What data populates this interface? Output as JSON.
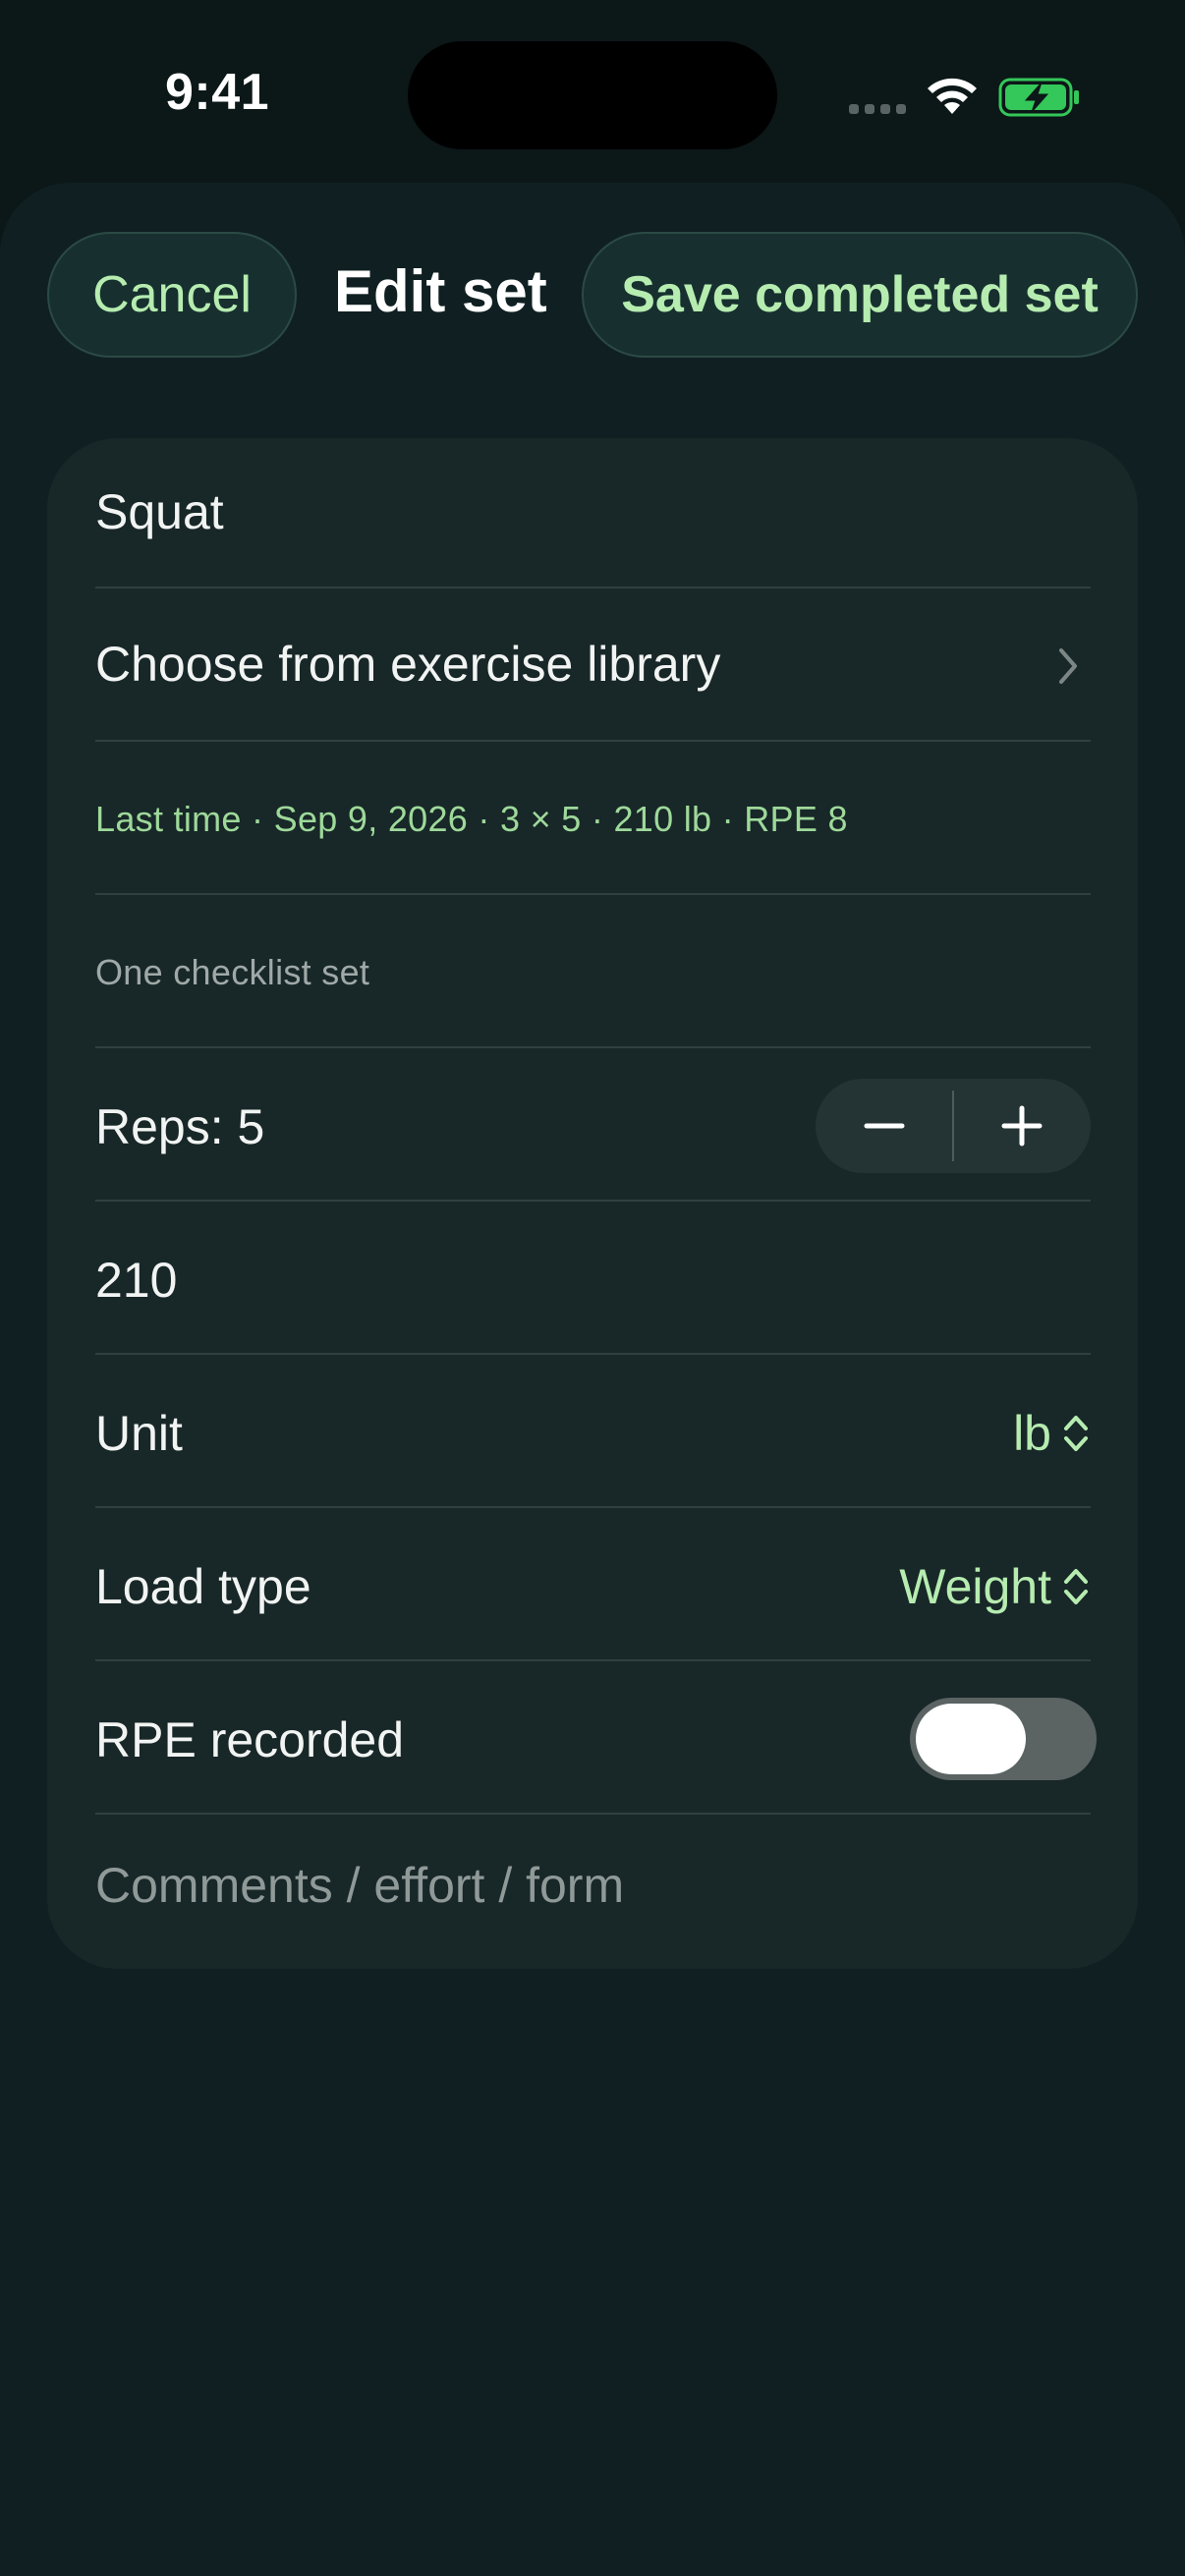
{
  "status_bar": {
    "time": "9:41"
  },
  "header": {
    "cancel_label": "Cancel",
    "title": "Edit set",
    "save_label": "Save completed set"
  },
  "form": {
    "exercise_name": "Squat",
    "library_link": "Choose from exercise library",
    "last_time": "Last time · Sep 9, 2026 · 3 × 5 · 210 lb · RPE 8",
    "set_mode": "One checklist set",
    "reps_label": "Reps: 5",
    "weight_value": "210",
    "unit_label": "Unit",
    "unit_value": "lb",
    "load_type_label": "Load type",
    "load_type_value": "Weight",
    "rpe_label": "RPE recorded",
    "rpe_recorded": false,
    "comments_placeholder": "Comments / effort / form"
  },
  "colors": {
    "background": "#0c1718",
    "sheet": "#102022",
    "card": "#182728",
    "accent": "#b6ecb0",
    "accent_muted": "#9ed99a",
    "battery": "#34c759"
  },
  "icons": {
    "signal": "cellular-signal-icon",
    "wifi": "wifi-icon",
    "battery": "battery-charging-icon",
    "chevron": "chevron-right-icon",
    "minus": "minus-icon",
    "plus": "plus-icon",
    "updown": "chevron-up-down-icon"
  }
}
